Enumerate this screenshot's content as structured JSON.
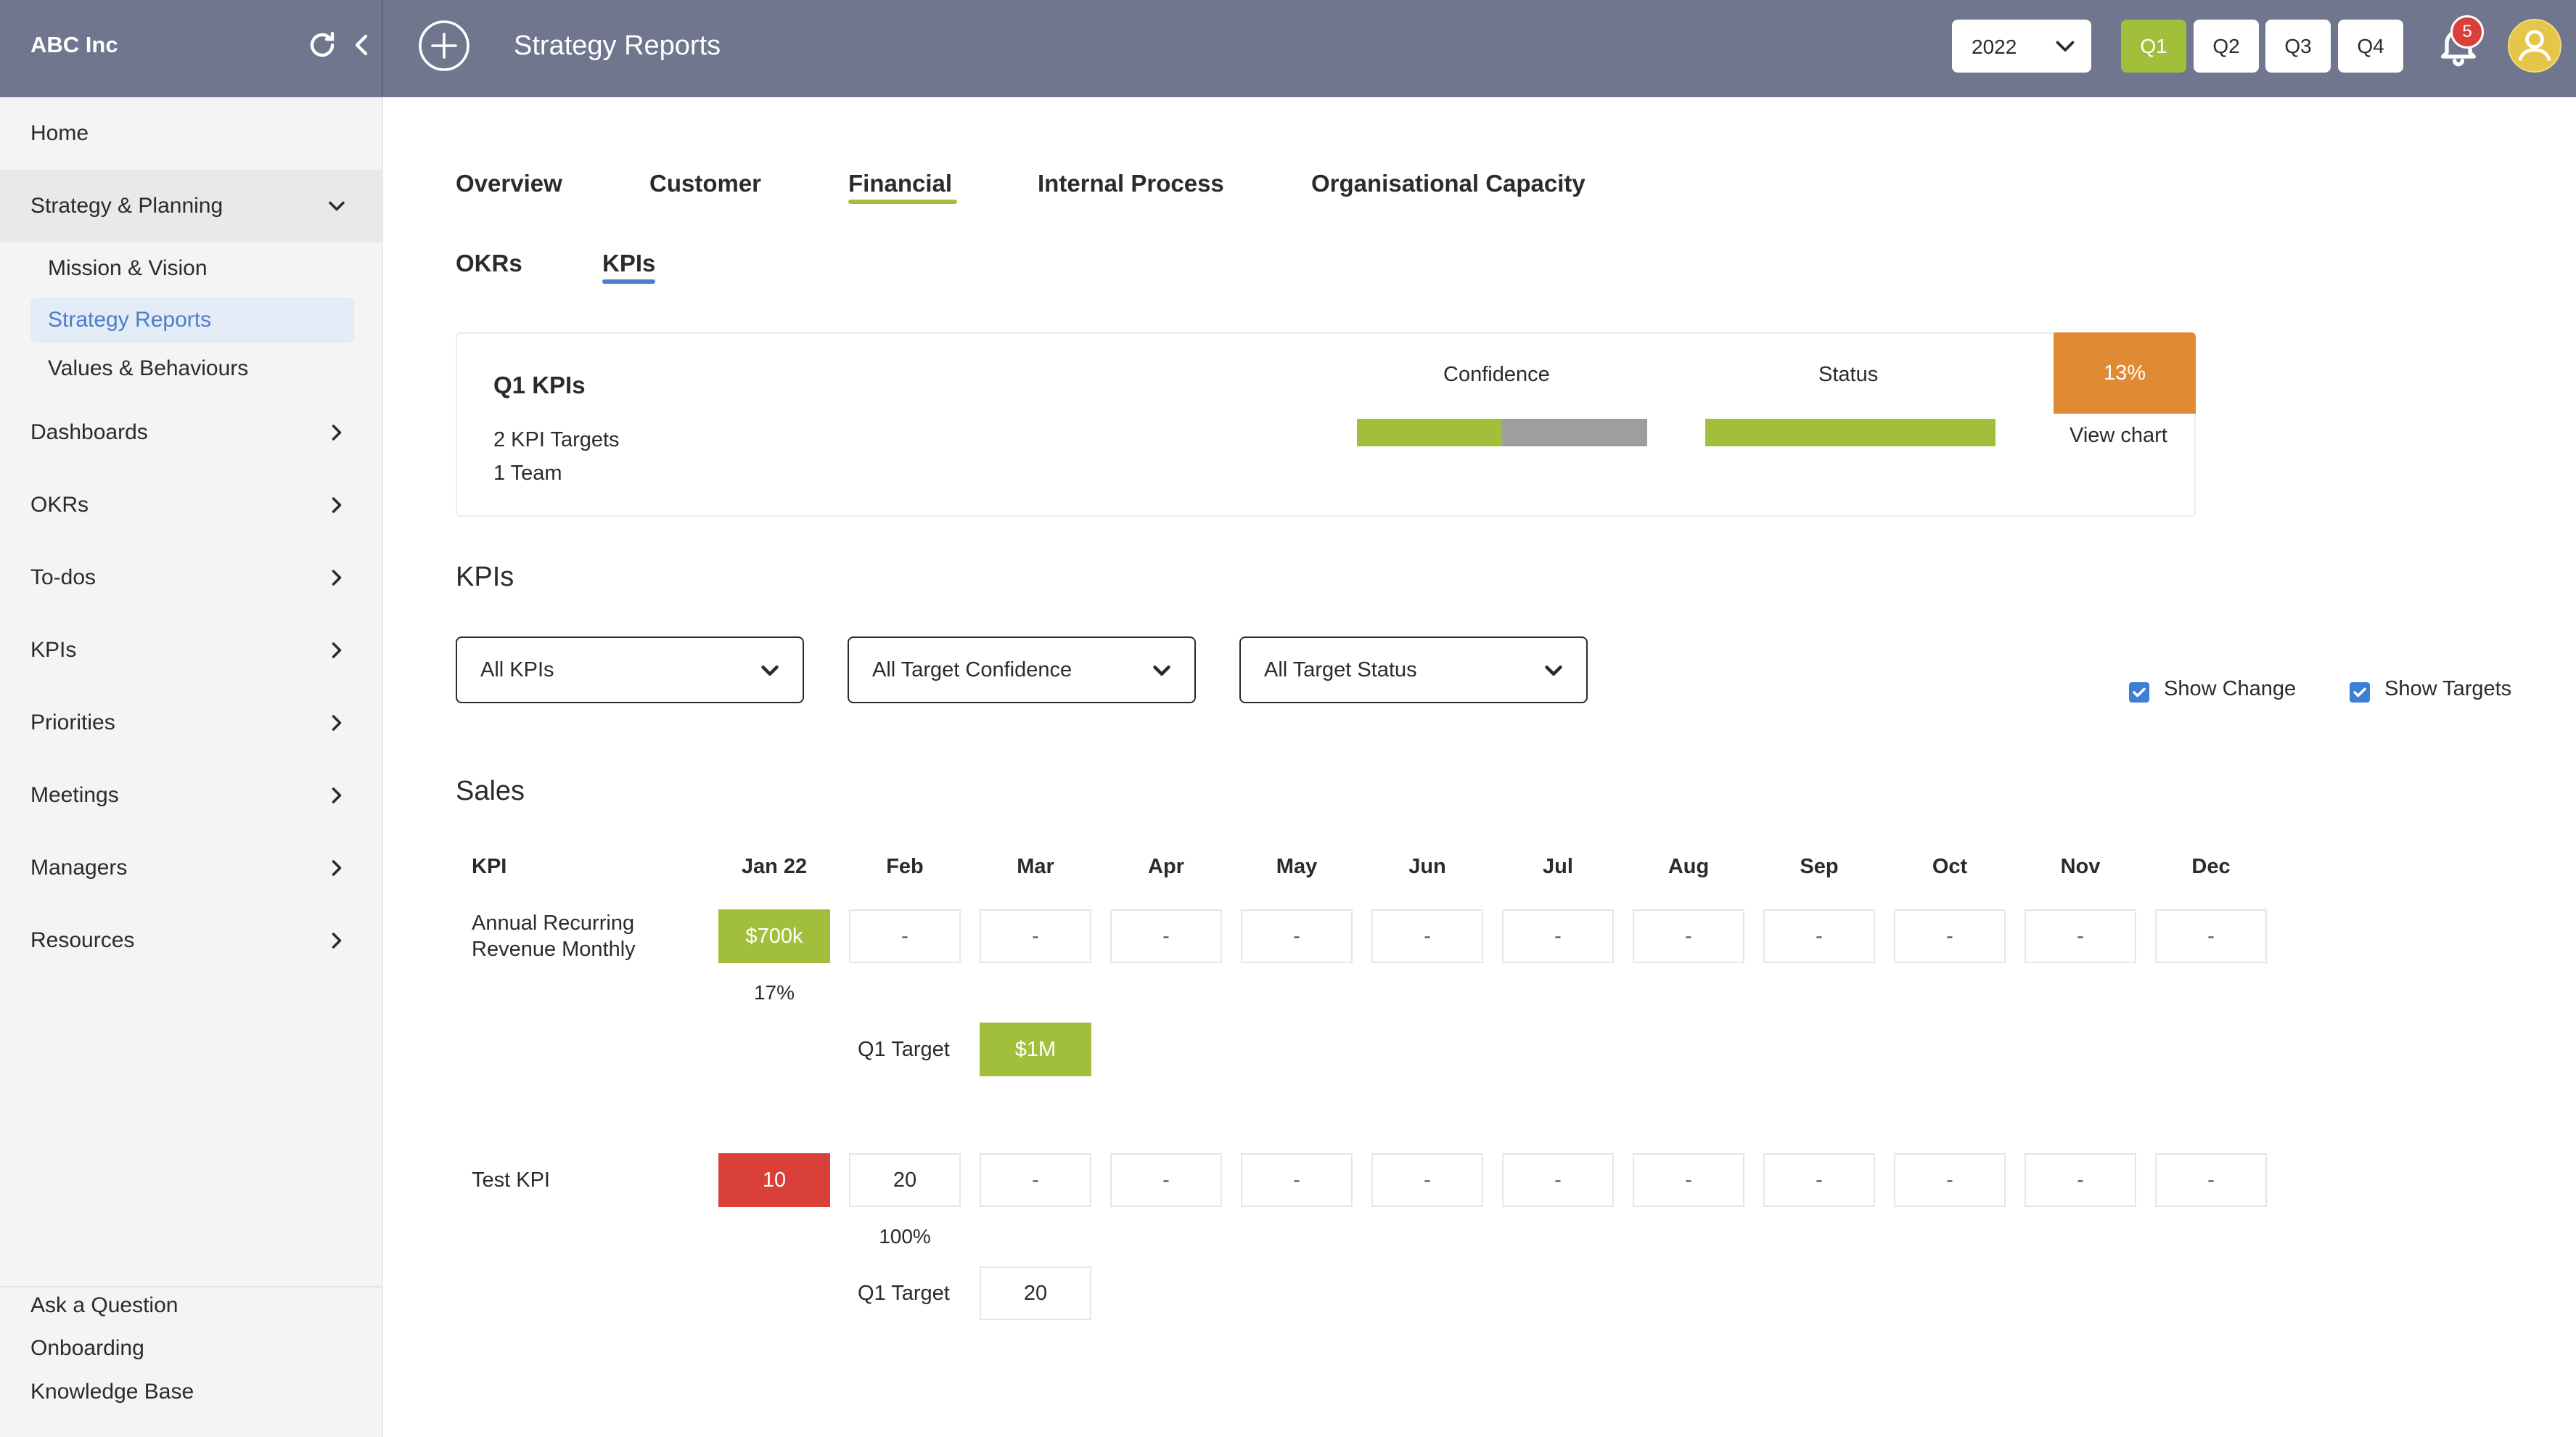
{
  "app": {
    "company": "ABC Inc",
    "page_title": "Strategy Reports"
  },
  "topbar": {
    "year": "2022",
    "quarters": [
      "Q1",
      "Q2",
      "Q3",
      "Q4"
    ],
    "active_quarter": "Q1",
    "notification_count": "5"
  },
  "sidebar": {
    "home": "Home",
    "strategy_planning": "Strategy & Planning",
    "sub_items": [
      "Mission & Vision",
      "Strategy Reports",
      "Values & Behaviours"
    ],
    "items": [
      "Dashboards",
      "OKRs",
      "To-dos",
      "KPIs",
      "Priorities",
      "Meetings",
      "Managers",
      "Resources"
    ],
    "footer": [
      "Ask a Question",
      "Onboarding",
      "Knowledge Base"
    ]
  },
  "tabs": {
    "main": [
      "Overview",
      "Customer",
      "Financial",
      "Internal Process",
      "Organisational Capacity"
    ],
    "active_main": "Financial",
    "sub": [
      "OKRs",
      "KPIs"
    ],
    "active_sub": "KPIs"
  },
  "summary": {
    "title": "Q1 KPIs",
    "targets": "2 KPI Targets",
    "teams": "1 Team",
    "confidence_label": "Confidence",
    "status_label": "Status",
    "confidence_split": [
      0.5,
      0.5
    ],
    "status_fill": 1.0,
    "percent": "13%",
    "view_chart": "View chart"
  },
  "kpis": {
    "section_title": "KPIs",
    "filters": [
      "All KPIs",
      "All Target Confidence",
      "All Target Status"
    ],
    "show_change": "Show Change",
    "show_targets": "Show Targets"
  },
  "sales": {
    "title": "Sales",
    "header_kpi": "KPI",
    "months": [
      "Jan 22",
      "Feb",
      "Mar",
      "Apr",
      "May",
      "Jun",
      "Jul",
      "Aug",
      "Sep",
      "Oct",
      "Nov",
      "Dec"
    ],
    "rows": [
      {
        "name_line1": "Annual Recurring",
        "name_line2": "Revenue Monthly",
        "values": [
          "$700k",
          "-",
          "-",
          "-",
          "-",
          "-",
          "-",
          "-",
          "-",
          "-",
          "-",
          "-"
        ],
        "change": "17%",
        "target_label": "Q1 Target",
        "target_value": "$1M"
      },
      {
        "name_line1": "Test KPI",
        "values": [
          "10",
          "20",
          "-",
          "-",
          "-",
          "-",
          "-",
          "-",
          "-",
          "-",
          "-",
          "-"
        ],
        "change": "100%",
        "target_label": "Q1 Target",
        "target_value": "20"
      }
    ]
  },
  "colors": {
    "topbar": "#6f768e",
    "accent_green": "#a2bf3c",
    "accent_blue": "#4a7fc9",
    "orange": "#e08a35",
    "red": "#d9403a",
    "grey_segment": "#9e9e9e"
  }
}
